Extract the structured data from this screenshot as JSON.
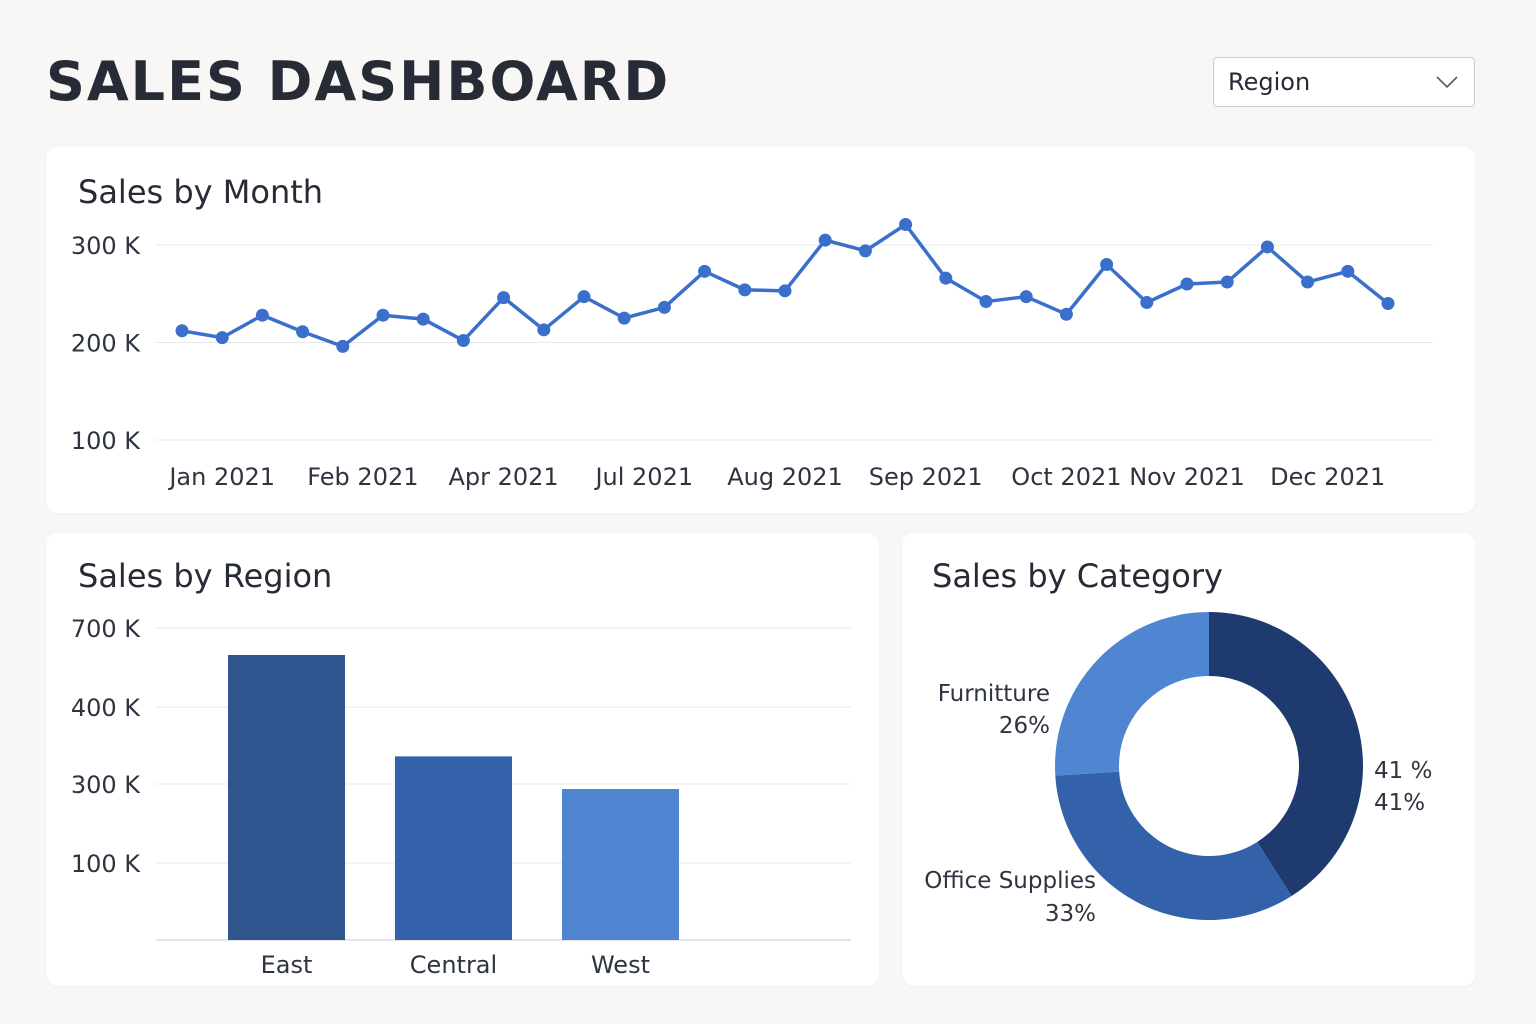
{
  "header": {
    "title": "SALES DASHBOARD",
    "region_select": {
      "selected": "Region",
      "icon": "chevron-down-icon"
    }
  },
  "colors": {
    "line": "#3a6fcc",
    "grid": "#e6e8ec",
    "bar_east": "#30548e",
    "bar_central": "#3462aa",
    "bar_west": "#5086d1",
    "pie_dark": "#1e3a6e",
    "pie_mid": "#3462aa",
    "pie_light": "#5086d1"
  },
  "chart_data": [
    {
      "type": "line",
      "title": "Sales by Month",
      "xlabel": "",
      "ylabel": "",
      "y_ticks": [
        "300 K",
        "200 K",
        "100 K"
      ],
      "y_tick_values": [
        300000,
        200000,
        100000
      ],
      "x_tick_labels": [
        "Jan 2021",
        "Feb 2021",
        "Apr 2021",
        "Jul 2021",
        "Aug 2021",
        "Sep 2021",
        "Oct 2021",
        "Nov 2021",
        "Dec 2021"
      ],
      "x_tick_positions": [
        1,
        4.5,
        8,
        11.5,
        15,
        18.5,
        22,
        25,
        28.5
      ],
      "grid": true,
      "series": [
        {
          "x": [
            0,
            1,
            2,
            3,
            4,
            5,
            6,
            7,
            8,
            9,
            10,
            11,
            12,
            13,
            14,
            15,
            16,
            17,
            18,
            19,
            20,
            21,
            22,
            23,
            24,
            25,
            26,
            27,
            28,
            29
          ],
          "values": [
            212000,
            205000,
            228000,
            211000,
            196000,
            228000,
            224000,
            202000,
            246000,
            213000,
            247000,
            225000,
            236000,
            273000,
            254000,
            253000,
            305000,
            294000,
            321000,
            266000,
            242000,
            247000,
            229000,
            280000,
            241000,
            260000,
            262000,
            298000,
            262000,
            273000
          ]
        }
      ],
      "last_point": {
        "x": 30,
        "value": 240000
      }
    },
    {
      "type": "bar",
      "title": "Sales by Region",
      "categories": [
        "East",
        "Central",
        "West"
      ],
      "values": [
        655000,
        422000,
        347000
      ],
      "y_ticks": [
        "700 K",
        "400 K",
        "300 K",
        "100 K"
      ],
      "grid": true
    },
    {
      "type": "pie",
      "title": "Sales by Category",
      "donut": true,
      "slices": [
        {
          "label": "",
          "percent_label": "41 %",
          "percent_label_2": "41%",
          "value": 41
        },
        {
          "label": "Office Supplies",
          "percent_label": "33%",
          "value": 33
        },
        {
          "label": "Furnitture",
          "percent_label": "26%",
          "value": 26
        }
      ]
    }
  ]
}
